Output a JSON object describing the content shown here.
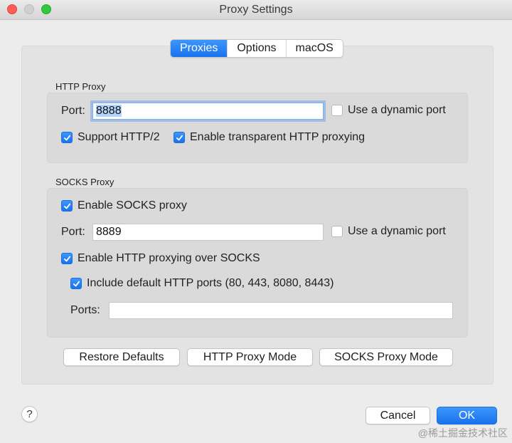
{
  "window": {
    "title": "Proxy Settings"
  },
  "tabs": [
    {
      "label": "Proxies",
      "active": true
    },
    {
      "label": "Options",
      "active": false
    },
    {
      "label": "macOS",
      "active": false
    }
  ],
  "http_proxy": {
    "section_label": "HTTP Proxy",
    "port_label": "Port:",
    "port_value": "8888",
    "dynamic_port": {
      "label": "Use a dynamic port",
      "checked": false
    },
    "support_http2": {
      "label": "Support HTTP/2",
      "checked": true
    },
    "transparent": {
      "label": "Enable transparent HTTP proxying",
      "checked": true
    }
  },
  "socks_proxy": {
    "section_label": "SOCKS Proxy",
    "enable_socks": {
      "label": "Enable SOCKS proxy",
      "checked": true
    },
    "port_label": "Port:",
    "port_value": "8889",
    "dynamic_port": {
      "label": "Use a dynamic port",
      "checked": false
    },
    "http_over_socks": {
      "label": "Enable HTTP proxying over SOCKS",
      "checked": true
    },
    "include_default_ports": {
      "label": "Include default HTTP ports (80, 443, 8080, 8443)",
      "checked": true
    },
    "ports_label": "Ports:",
    "ports_value": ""
  },
  "actions": {
    "restore_defaults": "Restore Defaults",
    "http_proxy_mode": "HTTP Proxy Mode",
    "socks_proxy_mode": "SOCKS Proxy Mode"
  },
  "footer": {
    "help": "?",
    "cancel": "Cancel",
    "ok": "OK"
  },
  "watermark": "@稀土掘金技术社区",
  "colors": {
    "accent": "#1a72ee",
    "panel": "#e3e3e3",
    "group": "#dadada"
  }
}
